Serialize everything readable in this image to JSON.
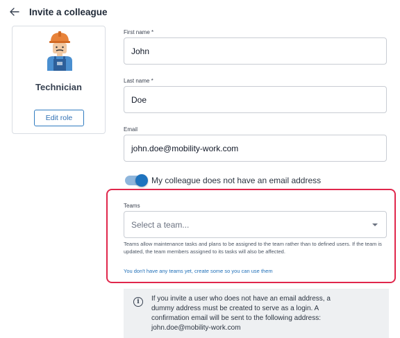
{
  "header": {
    "title": "Invite a colleague",
    "back_icon": "arrow-left-icon"
  },
  "role_card": {
    "role_name": "Technician",
    "edit_label": "Edit role",
    "avatar_icon": "technician-avatar-icon"
  },
  "form": {
    "first_name": {
      "label": "First name *",
      "value": "John"
    },
    "last_name": {
      "label": "Last name *",
      "value": "Doe"
    },
    "email": {
      "label": "Email",
      "value": "john.doe@mobility-work.com"
    },
    "no_email_toggle": {
      "label": "My colleague does not have an email address",
      "checked": true
    },
    "teams": {
      "label": "Teams",
      "placeholder": "Select a team...",
      "help": "Teams allow maintenance tasks and plans to be assigned to the team rather than to defined users. If the team is updated, the team members assigned to its tasks will also be affected.",
      "link": "You don't have any teams yet, create some so you can use them"
    },
    "info_message": {
      "line1": "If you invite a user who does not have an email address, a",
      "line2": "dummy address must be created to serve as a login. A",
      "line3": "confirmation email will be sent to the following address:",
      "line4": "john.doe@mobility-work.com"
    }
  },
  "colors": {
    "accent": "#1e73be",
    "highlight": "#e0264b"
  }
}
